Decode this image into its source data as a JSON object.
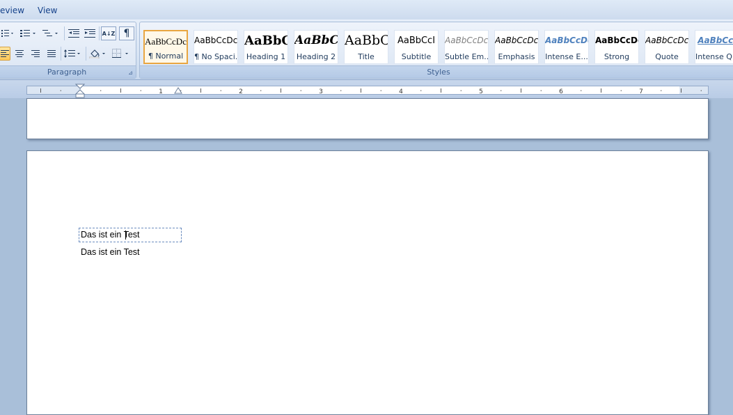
{
  "tabs": {
    "review": "eview",
    "view": "View"
  },
  "paragraph": {
    "label": "Paragraph",
    "sort_icon_text": "A↓Z",
    "pilcrow": "¶"
  },
  "styles": {
    "label": "Styles",
    "items": [
      {
        "sample": "AaBbCcDc",
        "name": "¶ Normal"
      },
      {
        "sample": "AaBbCcDc",
        "name": "¶ No Spaci..."
      },
      {
        "sample": "AaBbC(",
        "name": "Heading 1"
      },
      {
        "sample": "AaBbCc",
        "name": "Heading 2"
      },
      {
        "sample": "AaBbC(",
        "name": "Title"
      },
      {
        "sample": "AaBbCcI",
        "name": "Subtitle"
      },
      {
        "sample": "AaBbCcDc",
        "name": "Subtle Em..."
      },
      {
        "sample": "AaBbCcDc",
        "name": "Emphasis"
      },
      {
        "sample": "AaBbCcDc",
        "name": "Intense E..."
      },
      {
        "sample": "AaBbCcDc",
        "name": "Strong"
      },
      {
        "sample": "AaBbCcDc",
        "name": "Quote"
      },
      {
        "sample": "AaBbCcI",
        "name": "Intense Q..."
      }
    ]
  },
  "ruler": {
    "numbers": [
      "1",
      "2",
      "3",
      "4",
      "5",
      "6",
      "7"
    ]
  },
  "document": {
    "line1": "Das ist ein Test",
    "line2": "Das ist ein Test"
  },
  "colors": {
    "accent_selected": "#e9a641",
    "ribbon_text": "#15428b"
  }
}
